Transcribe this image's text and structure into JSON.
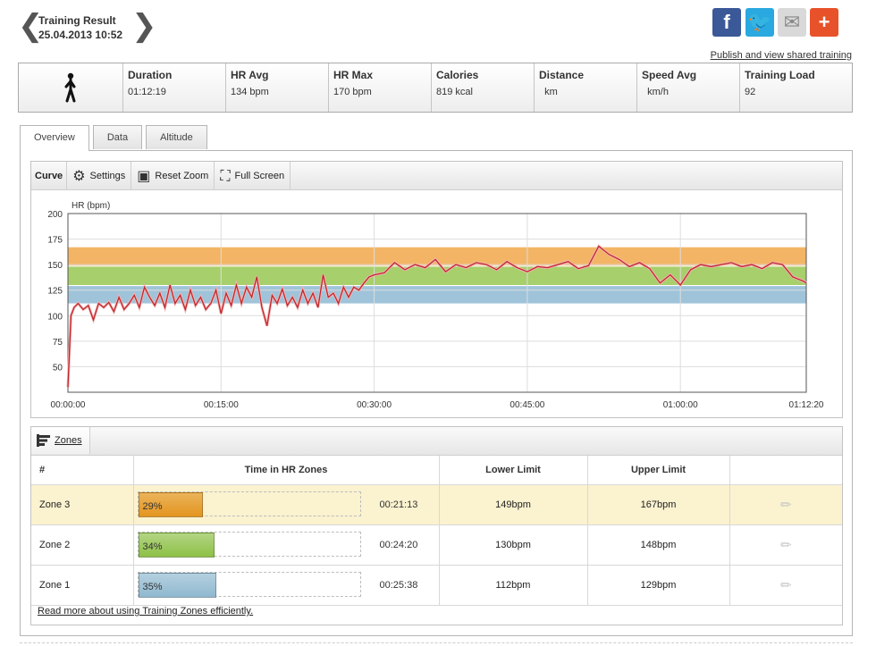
{
  "header": {
    "title": "Training Result",
    "datetime": "25.04.2013 10:52",
    "prev_glyph": "❮",
    "next_glyph": "❯",
    "publish_link": "Publish and view shared training"
  },
  "share": [
    {
      "name": "facebook-share-button",
      "glyph": "f",
      "color": "#3b5998"
    },
    {
      "name": "twitter-share-button",
      "glyph": "🐦",
      "color": "#2aa9e0"
    },
    {
      "name": "email-share-button",
      "glyph": "✉",
      "color": "#d9d9d9"
    },
    {
      "name": "more-share-button",
      "glyph": "+",
      "color": "#e8522a"
    }
  ],
  "summary": {
    "icon": "walking-person-icon",
    "items": [
      {
        "label": "Duration",
        "value": "01:12:19"
      },
      {
        "label": "HR Avg",
        "value": "134  bpm"
      },
      {
        "label": "HR Max",
        "value": "170  bpm"
      },
      {
        "label": "Calories",
        "value": "819  kcal"
      },
      {
        "label": "Distance",
        "value": "  km"
      },
      {
        "label": "Speed Avg",
        "value": "  km/h"
      },
      {
        "label": "Training Load",
        "value": "92"
      }
    ]
  },
  "tabs": [
    {
      "label": "Overview",
      "active": true
    },
    {
      "label": "Data",
      "active": false
    },
    {
      "label": "Altitude",
      "active": false
    }
  ],
  "toolbar": {
    "curve_label": "Curve",
    "settings_label": "Settings",
    "reset_zoom_label": "Reset Zoom",
    "full_screen_label": "Full Screen"
  },
  "chart_data": {
    "type": "line",
    "ylabel": "HR (bpm)",
    "xlabel": "",
    "ylim": [
      25,
      200
    ],
    "xlim_minutes": [
      0,
      72.33
    ],
    "yticks": [
      50,
      75,
      100,
      125,
      150,
      175,
      200
    ],
    "xticks": [
      "00:00:00",
      "00:15:00",
      "00:30:00",
      "00:45:00",
      "01:00:00",
      "01:12:20"
    ],
    "grid": true,
    "zone_bands": [
      {
        "name": "Zone 3",
        "lower": 149,
        "upper": 167,
        "color": "#f3b565"
      },
      {
        "name": "Zone 2",
        "lower": 130,
        "upper": 148,
        "color": "#a7cf6b"
      },
      {
        "name": "Zone 1",
        "lower": 112,
        "upper": 129,
        "color": "#9fc4da"
      }
    ],
    "series": [
      {
        "color": "#c0272d",
        "x": [
          0,
          0.3,
          0.6,
          1,
          1.5,
          2,
          2.5,
          3,
          3.5,
          4,
          4.5,
          5,
          5.5,
          6,
          6.5,
          7,
          7.5,
          8,
          8.5,
          9,
          9.5,
          10,
          10.5,
          11,
          11.5,
          12,
          12.5,
          13,
          13.5,
          14,
          14.5,
          15,
          15.5,
          16,
          16.5,
          17,
          17.5,
          18,
          18.5,
          19,
          19.5,
          20,
          20.5,
          21,
          21.5,
          22,
          22.5,
          23,
          23.5,
          24,
          24.5,
          25,
          25.5,
          26,
          26.5,
          27,
          27.5,
          28,
          28.5,
          29,
          29.5,
          30,
          31,
          32,
          33,
          34,
          35,
          36,
          37,
          38,
          39,
          40,
          41,
          42,
          43,
          44,
          45,
          46,
          47,
          48,
          49,
          50,
          51,
          52,
          53,
          54,
          55,
          56,
          57,
          58,
          59,
          60,
          61,
          62,
          63,
          64,
          65,
          66,
          67,
          68,
          69,
          70,
          71,
          72,
          72.33
        ],
        "y": [
          30,
          100,
          108,
          112,
          106,
          110,
          96,
          112,
          108,
          113,
          104,
          118,
          106,
          112,
          120,
          108,
          128,
          118,
          110,
          122,
          108,
          130,
          112,
          120,
          106,
          125,
          110,
          118,
          106,
          112,
          125,
          102,
          122,
          110,
          130,
          112,
          128,
          118,
          138,
          108,
          90,
          120,
          112,
          126,
          110,
          118,
          108,
          125,
          112,
          122,
          108,
          140,
          118,
          122,
          112,
          128,
          118,
          128,
          125,
          132,
          138,
          140,
          142,
          152,
          145,
          150,
          147,
          155,
          143,
          150,
          147,
          152,
          150,
          145,
          153,
          147,
          143,
          148,
          147,
          150,
          153,
          146,
          149,
          168,
          160,
          155,
          148,
          152,
          146,
          132,
          140,
          130,
          145,
          150,
          148,
          150,
          152,
          148,
          150,
          146,
          152,
          150,
          138,
          134,
          132
        ]
      }
    ]
  },
  "zones": {
    "tab_label": "Zones",
    "columns": [
      "#",
      "Time in HR Zones",
      "Lower Limit",
      "Upper Limit"
    ],
    "rows": [
      {
        "name": "Zone 3",
        "percent_label": "29%",
        "fraction": 0.29,
        "time": "00:21:13",
        "lower": "149bpm",
        "upper": "167bpm",
        "color": "#e3941f",
        "highlight": true
      },
      {
        "name": "Zone 2",
        "percent_label": "34%",
        "fraction": 0.34,
        "time": "00:24:20",
        "lower": "130bpm",
        "upper": "148bpm",
        "color": "#8dc046",
        "highlight": false
      },
      {
        "name": "Zone 1",
        "percent_label": "35%",
        "fraction": 0.35,
        "time": "00:25:38",
        "lower": "112bpm",
        "upper": "129bpm",
        "color": "#8fb8cf",
        "highlight": false
      }
    ],
    "read_more": "Read more about using Training Zones efficiently."
  }
}
